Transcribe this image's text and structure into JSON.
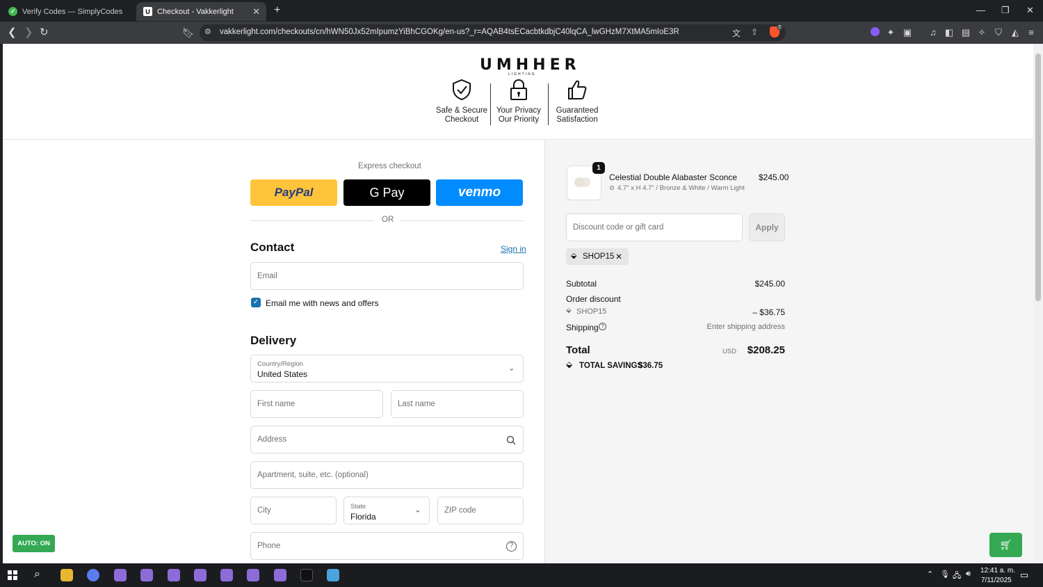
{
  "browser": {
    "tabs": [
      {
        "title": "Verify Codes — SimplyCodes"
      },
      {
        "title": "Checkout - Vakkerlight"
      }
    ],
    "url": "vakkerlight.com/checkouts/cn/hWN50Jx52mIpumzYiBhCGOKg/en-us?_r=AQAB4tsECacbtkdbjC40lqCA_lwGHzM7XtMA5mIoE3R",
    "brave_badge": "7"
  },
  "header": {
    "logo_text": "UMHHER",
    "logo_sub": "LIGHTING",
    "badges": [
      {
        "line1": "Safe & Secure",
        "line2": "Checkout"
      },
      {
        "line1": "Your Privacy",
        "line2": "Our Priority"
      },
      {
        "line1": "Guaranteed",
        "line2": "Satisfaction"
      }
    ]
  },
  "checkout": {
    "express_label": "Express checkout",
    "paypal": "PayPal",
    "gpay": "G Pay",
    "venmo": "venmo",
    "or_label": "OR",
    "contact_title": "Contact",
    "sign_in": "Sign in",
    "email_placeholder": "Email",
    "newsletter_label": "Email me with news and offers",
    "delivery_title": "Delivery",
    "country_label": "Country/Region",
    "country_value": "United States",
    "first_name_ph": "First name",
    "last_name_ph": "Last name",
    "address_ph": "Address",
    "apartment_ph": "Apartment, suite, etc. (optional)",
    "city_ph": "City",
    "state_label": "State",
    "state_value": "Florida",
    "zip_ph": "ZIP code",
    "phone_ph": "Phone"
  },
  "summary": {
    "qty_badge": "1",
    "product_name": "Celestial Double Alabaster Sconce",
    "product_variant": "4.7\" x H 4.7\" / Bronze & White / Warm Light",
    "product_price": "$245.00",
    "discount_ph": "Discount code or gift card",
    "apply": "Apply",
    "code_chip": "SHOP15",
    "subtotal_label": "Subtotal",
    "subtotal_value": "$245.00",
    "order_discount_label": "Order discount",
    "discount_code": "SHOP15",
    "discount_value": "– $36.75",
    "shipping_label": "Shipping",
    "shipping_value": "Enter shipping address",
    "total_label": "Total",
    "currency": "USD",
    "total_value": "$208.25",
    "savings_label": "TOTAL SAVINGS",
    "savings_value": "$36.75"
  },
  "overlays": {
    "auto_badge": "AUTO: ON"
  },
  "taskbar": {
    "time": "12:41 a. m.",
    "date": "7/11/2025"
  },
  "colors": {
    "paypal": "#ffc439",
    "venmo": "#008cff",
    "link": "#1773b0",
    "checkbox": "#1773b0",
    "auto_green": "#34a853"
  }
}
